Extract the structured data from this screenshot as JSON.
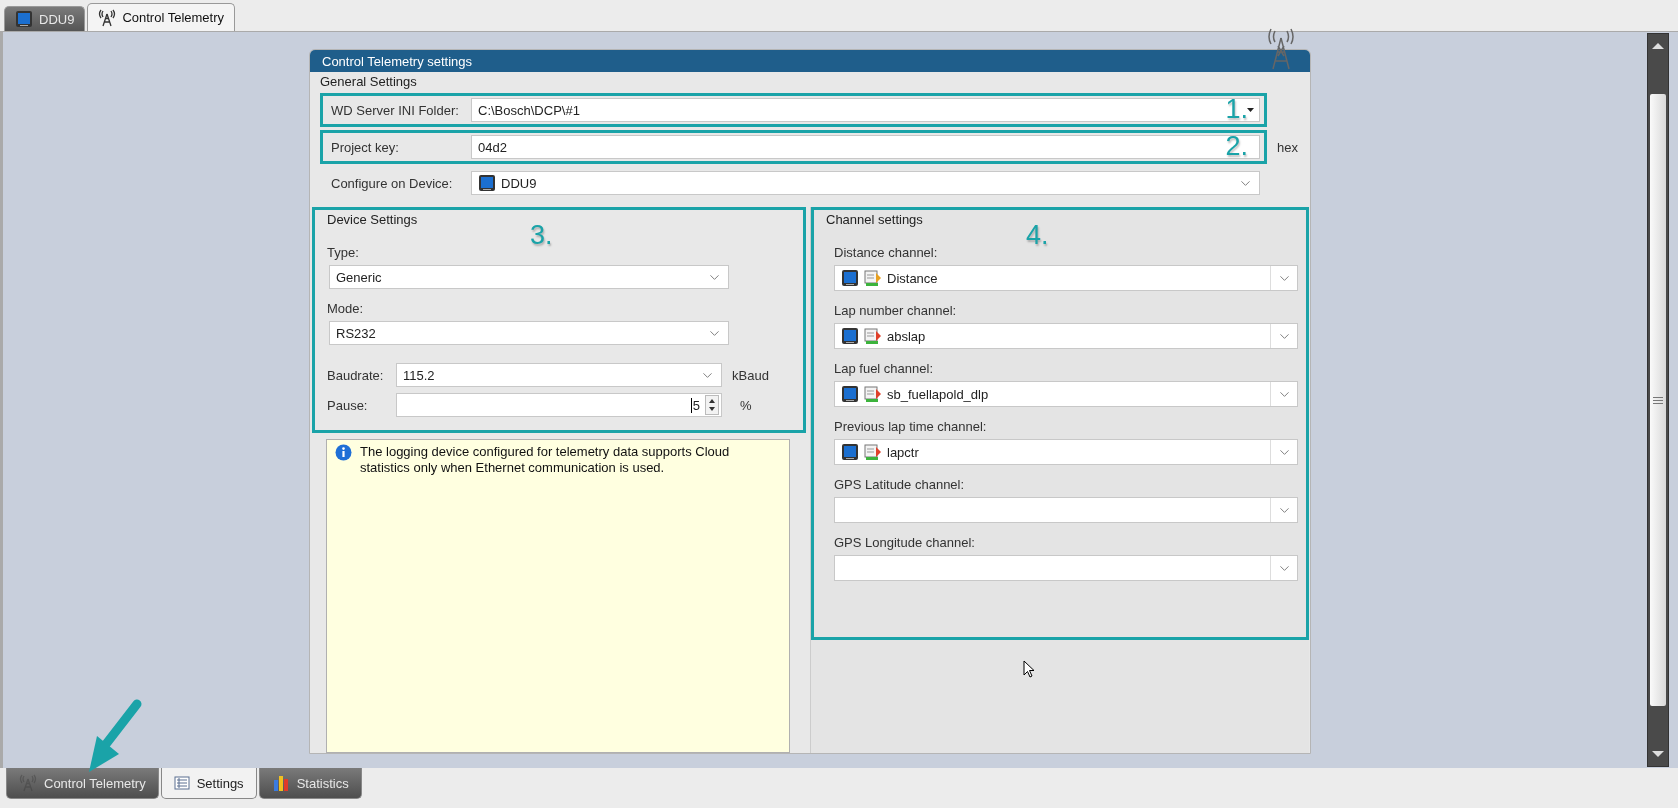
{
  "doc_tabs": [
    {
      "label": "DDU9",
      "kind": "device",
      "selected": false
    },
    {
      "label": "Control Telemetry",
      "kind": "antenna",
      "selected": true
    }
  ],
  "panel": {
    "title": "Control Telemetry settings",
    "general": {
      "heading": "General Settings",
      "rows": [
        {
          "label": "WD Server INI Folder:",
          "value": "C:\\Bosch\\DCP\\#1",
          "kind": "path",
          "marker": "1."
        },
        {
          "label": "Project key:",
          "value": "04d2",
          "kind": "text",
          "marker": "2.",
          "unit": "hex"
        },
        {
          "label": "Configure on Device:",
          "value": "DDU9",
          "kind": "device"
        }
      ]
    },
    "device": {
      "heading": "Device Settings",
      "marker": "3.",
      "type": {
        "label": "Type:",
        "value": "Generic"
      },
      "mode": {
        "label": "Mode:",
        "value": "RS232"
      },
      "baudrate": {
        "label": "Baudrate:",
        "value": "115.2",
        "unit": "kBaud"
      },
      "pause": {
        "label": "Pause:",
        "value": "5",
        "unit": "%"
      }
    },
    "info": {
      "text": "The logging device configured for telemetry data supports Cloud statistics only when Ethernet communication is used."
    },
    "channels": {
      "heading": "Channel settings",
      "marker": "4.",
      "items": [
        {
          "label": "Distance channel:",
          "value": "Distance",
          "kind": "input"
        },
        {
          "label": "Lap number channel:",
          "value": "abslap",
          "kind": "calculated"
        },
        {
          "label": "Lap fuel channel:",
          "value": "sb_fuellapold_dlp",
          "kind": "calculated"
        },
        {
          "label": "Previous lap time channel:",
          "value": "lapctr",
          "kind": "calculated"
        },
        {
          "label": "GPS Latitude channel:"
        },
        {
          "label": "GPS Longitude channel:"
        }
      ]
    }
  },
  "bottom_tabs": [
    {
      "label": "Control Telemetry",
      "kind": "antenna",
      "selected": false
    },
    {
      "label": "Settings",
      "kind": "list",
      "selected": true
    },
    {
      "label": "Statistics",
      "kind": "chart",
      "selected": false
    }
  ]
}
